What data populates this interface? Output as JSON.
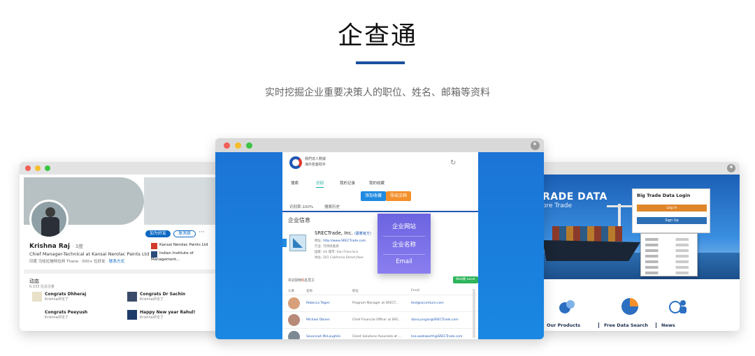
{
  "header": {
    "title": "企查通",
    "subtitle": "实时挖掘企业重要决策人的职位、姓名、邮箱等资料"
  },
  "left_window": {
    "profile": {
      "name": "Krishna Raj",
      "degree": "· 3度",
      "headline": "Chief Manager-Technical at Kansai Nerolac Paints Ltd",
      "location_prefix": "印度 马哈拉施特拉邦 Thane · 500+ 位好友 ·",
      "contact_link": "联系方式",
      "connect_button": "加为好友",
      "message_button": "发消息",
      "more": "···",
      "orgs": [
        {
          "label": "Kansai Nerolac Paints Ltd"
        },
        {
          "label": "Indian Institute of Management..."
        }
      ]
    },
    "activity": {
      "title": "动态",
      "followers": "6,333 位关注者",
      "posts": [
        {
          "title": "Congrats Dhheraj",
          "by": "Krishna评论了"
        },
        {
          "title": "Congrats Dr Sachin",
          "by": "Krishna评论了"
        },
        {
          "title": "Congrats Peeyush",
          "by": "Krishna评论了"
        },
        {
          "title": "Happy New year Rahul!",
          "by": "Krishna评论了"
        }
      ]
    }
  },
  "mid_window": {
    "logo_text_1": "我們達人數據",
    "logo_text_2": "海外拓客助手",
    "tabs": [
      "搜索",
      "识别",
      "我的记录",
      "我的收藏"
    ],
    "active_tab": 1,
    "buttons": {
      "primary": "添加收藏",
      "secondary": "导出文档"
    },
    "stats": [
      "识别率:100%",
      "搜索历史"
    ],
    "section_title": "企业信息",
    "company": {
      "name": "SRECTrade, Inc.",
      "verified": "(跟着官方)",
      "website_label": "网址:",
      "website": "http://www.SRECTrade.com",
      "industry": "行业: 可持续能源",
      "location": "国家: US 城市: San Francisco",
      "address": "地址: 201 California Street,floor"
    },
    "menu": [
      "企业网站",
      "企业名称",
      "Email"
    ],
    "employees": {
      "header_prefix": "共识别到",
      "header_highlight": "6",
      "header_suffix": "名员工",
      "export": "Web版 excel",
      "columns": [
        "头像",
        "名称",
        "职位",
        "Email"
      ],
      "rows": [
        {
          "name": "Rebecca Tegen",
          "title": "Program Manager at SRECT...",
          "email": "test@accenture.com"
        },
        {
          "name": "Michael Obrien",
          "title": "Chief Financial Officer at SRE...",
          "email": "danny.organ@SRECTrade.com"
        },
        {
          "name": "Savannah McLaughlin",
          "title": "Client Solutions Associate at ...",
          "email": "lisa.wadsworth@SRECTrade.com"
        }
      ]
    }
  },
  "right_window": {
    "banner_title": "RADE DATA",
    "banner_sub": "ore Trade",
    "login_title": "Big Trade Data Login",
    "login_btn": "Log in",
    "signup_btn": "Sign Up",
    "nav": [
      {
        "label": "Our Products",
        "icon": "products-icon"
      },
      {
        "label": "Free Data Search",
        "icon": "chart-pie-icon"
      },
      {
        "label": "News",
        "icon": "globe-users-icon"
      }
    ]
  },
  "colors": {
    "accent": "#1a4f9c",
    "panel_blue": "#1b74d6",
    "menu_purple": "#7a70e8",
    "orange": "#f3902b"
  }
}
